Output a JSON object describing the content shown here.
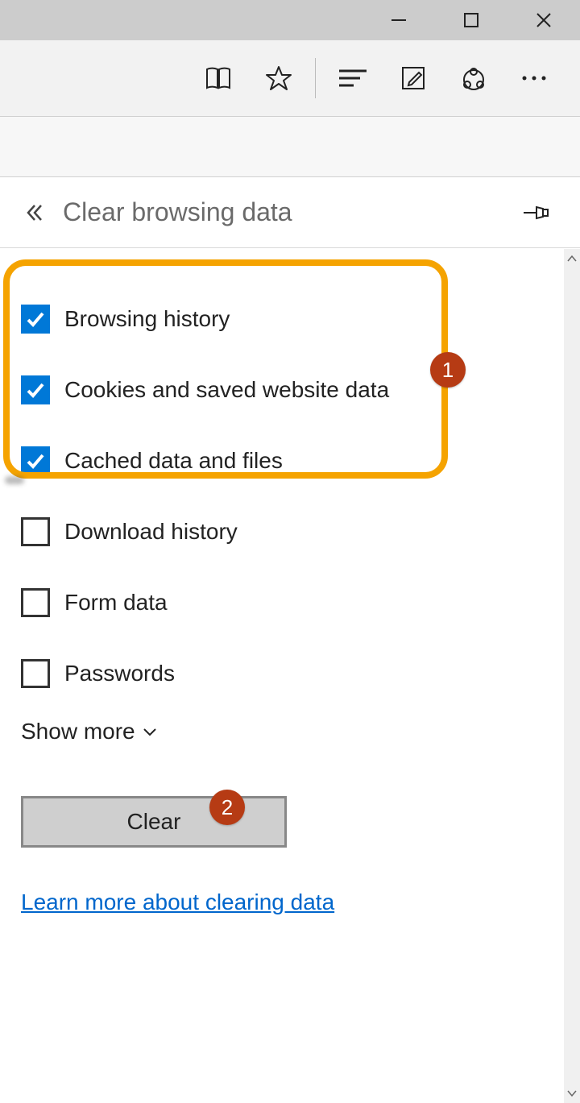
{
  "window": {
    "minimize": "–",
    "maximize": "◻",
    "close": "✕"
  },
  "panel": {
    "title": "Clear browsing data"
  },
  "options": [
    {
      "label": "Browsing history",
      "checked": true
    },
    {
      "label": "Cookies and saved website data",
      "checked": true
    },
    {
      "label": "Cached data and files",
      "checked": true
    },
    {
      "label": "Download history",
      "checked": false
    },
    {
      "label": "Form data",
      "checked": false
    },
    {
      "label": "Passwords",
      "checked": false
    }
  ],
  "show_more": "Show more",
  "clear_button": "Clear",
  "learn_link": "Learn more about clearing data",
  "callouts": {
    "one": "1",
    "two": "2"
  }
}
